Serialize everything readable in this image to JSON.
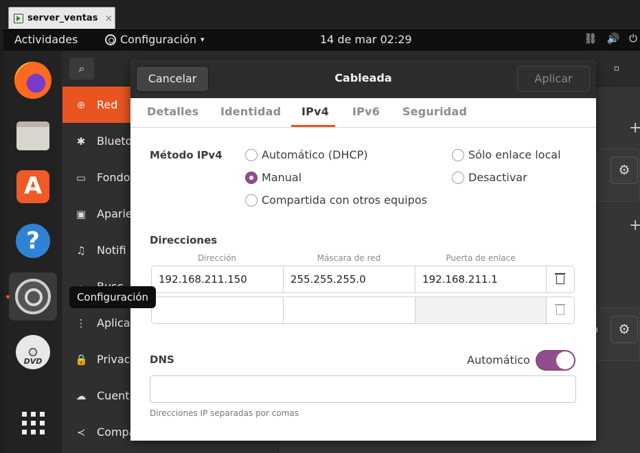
{
  "host": {
    "tab_title": "server_ventas",
    "tab_close": "×"
  },
  "topbar": {
    "activities": "Actividades",
    "app_menu": "Configuración",
    "app_menu_caret": "▾",
    "datetime": "14 de mar  02:29",
    "tray": {
      "network": "⛓",
      "volume": "🔊",
      "power": "⏻"
    }
  },
  "dock": {
    "items": [
      "firefox-icon",
      "files-icon",
      "software-store-icon",
      "help-icon",
      "settings-icon",
      "dvd-icon",
      "show-apps-icon"
    ],
    "store_glyph": "A",
    "help_glyph": "?",
    "dvd_text": "DVD"
  },
  "tooltip": "Configuración",
  "app": {
    "search_glyph": "⌕",
    "sidebar": [
      {
        "icon": "⊕",
        "label": "Red"
      },
      {
        "icon": "✱",
        "label": "Blueto"
      },
      {
        "icon": "▭",
        "label": "Fondo"
      },
      {
        "icon": "▣",
        "label": "Aparie"
      },
      {
        "icon": "♫",
        "label": "Notifi"
      },
      {
        "icon": "⌕",
        "label": "Busc"
      },
      {
        "icon": "⋮",
        "label": "Aplica"
      },
      {
        "icon": "🔒",
        "label": "Privaci"
      },
      {
        "icon": "☁",
        "label": "Cuenta"
      },
      {
        "icon": "≺",
        "label": "Compa"
      }
    ],
    "main_partial_text": "o"
  },
  "dialog": {
    "title": "Cableada",
    "cancel": "Cancelar",
    "apply": "Aplicar",
    "tabs": [
      "Detalles",
      "Identidad",
      "IPv4",
      "IPv6",
      "Seguridad"
    ],
    "active_tab": "IPv4",
    "method": {
      "label": "Método IPv4",
      "options": {
        "automatic": "Automático (DHCP)",
        "link_local": "Sólo enlace local",
        "manual": "Manual",
        "disable": "Desactivar",
        "shared": "Compartida con otros equipos"
      },
      "selected": "Manual"
    },
    "addresses": {
      "heading": "Direcciones",
      "columns": [
        "Dirección",
        "Máscara de red",
        "Puerta de enlace"
      ],
      "rows": [
        [
          "192.168.211.150",
          "255.255.255.0",
          "192.168.211.1"
        ],
        [
          "",
          "",
          ""
        ]
      ]
    },
    "dns": {
      "heading": "DNS",
      "auto_label": "Automático",
      "auto_enabled": true,
      "value": "",
      "hint": "Direcciones IP separadas por comas"
    }
  },
  "colors": {
    "accent": "#e95420",
    "toggle": "#924d8b"
  }
}
